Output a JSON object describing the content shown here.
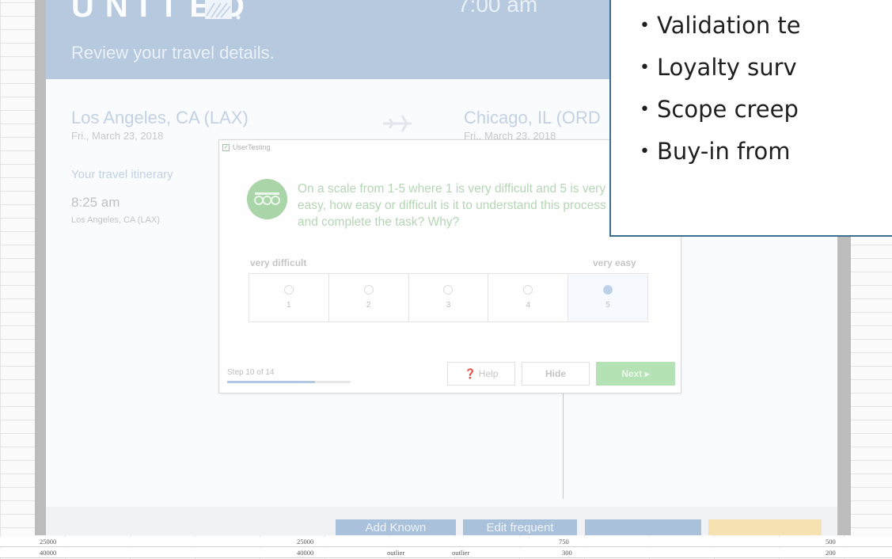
{
  "spreadsheet": {
    "rows": [
      [
        "25000",
        "25000",
        "750",
        "500"
      ],
      [
        "40000",
        "40000",
        "outlier",
        "outlier",
        "300",
        "200"
      ]
    ]
  },
  "app": {
    "brand": "UNITED",
    "header_time": "7:00 am",
    "header_subtitle": "Review your travel details."
  },
  "trip": {
    "from_city": "Los Angeles, CA (LAX)",
    "from_date": "Fri., March 23, 2018",
    "to_city": "Chicago, IL (ORD",
    "to_date": "Fri., March 23, 2018",
    "itinerary_heading": "Your travel itinerary",
    "depart_time": "8:25 am",
    "depart_airport": "Los Angeles, CA (LAX)"
  },
  "bottom_buttons": [
    "Add Known",
    "Edit frequent",
    "",
    ""
  ],
  "usertesting": {
    "title": "UserTesting",
    "question": "On a scale from 1-5 where 1 is very difficult and 5 is very easy, how easy or difficult is it to understand this process and complete the task? Why?",
    "low_label": "very difficult",
    "high_label": "very easy",
    "options": [
      "1",
      "2",
      "3",
      "4",
      "5"
    ],
    "selected_option": "5",
    "step_text": "Step 10 of 14",
    "progress": 0.714,
    "help_label": "Help",
    "hide_label": "Hide",
    "next_label": "Next ▸"
  },
  "callout": {
    "items": [
      "Validation te",
      "Loyalty surv",
      "Scope creep",
      "Buy-in from"
    ]
  },
  "colors": {
    "header_bg": "#b7c9de",
    "callout_border": "#3c6e8f",
    "next_button": "#b5e2b5"
  }
}
